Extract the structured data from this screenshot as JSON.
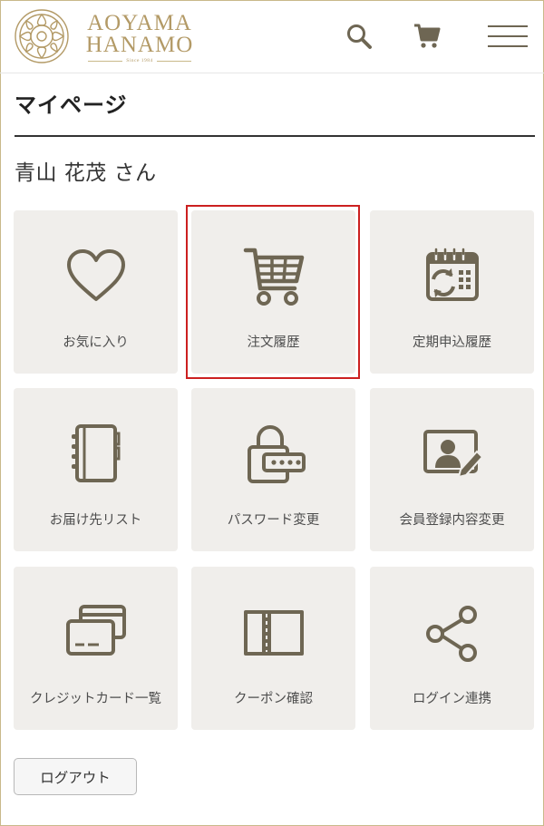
{
  "header": {
    "logo_line1": "AOYAMA",
    "logo_line2": "HANAMO",
    "logo_since": "Since 1984",
    "brand_color": "#b39a66",
    "icons": [
      "search-icon",
      "cart-icon",
      "hamburger-menu-icon"
    ]
  },
  "page": {
    "title": "マイページ",
    "user_name": "青山 花茂 さん"
  },
  "menu": {
    "items": [
      {
        "label": "お気に入り",
        "icon": "heart-icon"
      },
      {
        "label": "注文履歴",
        "icon": "cart-icon",
        "highlighted": true
      },
      {
        "label": "定期申込履歴",
        "icon": "calendar-refresh-icon"
      },
      {
        "label": "お届け先リスト",
        "icon": "address-book-icon"
      },
      {
        "label": "パスワード変更",
        "icon": "lock-password-icon"
      },
      {
        "label": "会員登録内容変更",
        "icon": "profile-edit-icon"
      },
      {
        "label": "クレジットカード一覧",
        "icon": "credit-card-icon"
      },
      {
        "label": "クーポン確認",
        "icon": "coupon-ticket-icon"
      },
      {
        "label": "ログイン連携",
        "icon": "share-icon"
      }
    ]
  },
  "logout_label": "ログアウト",
  "colors": {
    "tile_bg": "#f0eeeb",
    "icon": "#6e6653",
    "highlight_border": "#cc2020"
  }
}
